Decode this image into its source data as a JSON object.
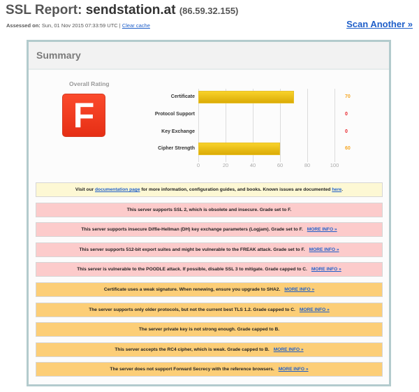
{
  "header": {
    "title_prefix": "SSL Report: ",
    "host": "sendstation.at",
    "ip": "(86.59.32.155)",
    "assessed_label": "Assessed on:",
    "assessed_value": "Sun, 01 Nov 2015 07:33:59 UTC",
    "separator": "|",
    "clear_cache": "Clear cache",
    "scan_another": "Scan Another »"
  },
  "summary": {
    "heading": "Summary",
    "overall_label": "Overall Rating",
    "grade": "F",
    "grade_color": "#f03e20"
  },
  "chart_data": {
    "type": "bar",
    "orientation": "horizontal",
    "categories": [
      "Certificate",
      "Protocol Support",
      "Key Exchange",
      "Cipher Strength"
    ],
    "values": [
      70,
      0,
      0,
      60
    ],
    "value_labels": [
      "70",
      "0",
      "0",
      "60"
    ],
    "value_label_colors": [
      "#f5a623",
      "#e8242a",
      "#e8242a",
      "#f5a623"
    ],
    "xlim": [
      0,
      100
    ],
    "xticks": [
      "0",
      "20",
      "40",
      "60",
      "80",
      "100"
    ],
    "grid": true,
    "bar_color": "#f0c419",
    "title": "",
    "xlabel": "",
    "ylabel": ""
  },
  "notices": [
    {
      "type": "info",
      "parts": [
        "Visit our ",
        "documentation page",
        " for more information, configuration guides, and books. Known issues are documented ",
        "here",
        "."
      ]
    },
    {
      "type": "error",
      "text": "This server supports SSL 2, which is obsolete and insecure. Grade set to F.",
      "link": ""
    },
    {
      "type": "error",
      "text": "This server supports insecure Diffie-Hellman (DH) key exchange parameters (Logjam). Grade set to F.",
      "link": "MORE INFO »"
    },
    {
      "type": "error",
      "text": "This server supports 512-bit export suites and might be vulnerable to the FREAK attack. Grade set to F.",
      "link": "MORE INFO »"
    },
    {
      "type": "error",
      "text": "This server is vulnerable to the POODLE attack. If possible, disable SSL 3 to mitigate. Grade capped to C.",
      "link": "MORE INFO »"
    },
    {
      "type": "warning",
      "text": "Certificate uses a weak signature. When renewing, ensure you upgrade to SHA2.",
      "link": "MORE INFO »"
    },
    {
      "type": "warning",
      "text": "The server supports only older protocols, but not the current best TLS 1.2. Grade capped to C.",
      "link": "MORE INFO »"
    },
    {
      "type": "warning",
      "text": "The server private key is not strong enough. Grade capped to B.",
      "link": ""
    },
    {
      "type": "warning",
      "text": "This server accepts the RC4 cipher, which is weak. Grade capped to B.",
      "link": "MORE INFO »"
    },
    {
      "type": "warning",
      "text": "The server does not support Forward Secrecy with the reference browsers.",
      "link": "MORE INFO »"
    }
  ]
}
